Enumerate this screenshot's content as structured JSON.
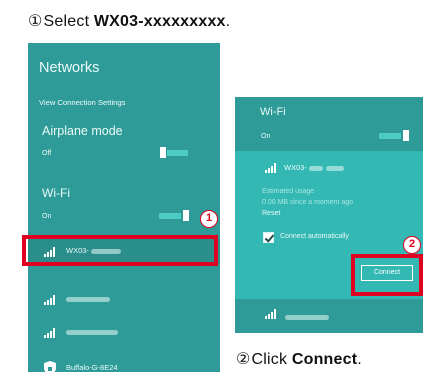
{
  "captions": {
    "step1_num": "①",
    "step1_prefix": "Select ",
    "step1_ssid": "WX03-xxxxxxxxx",
    "step1_suffix": ".",
    "step2_num": "②",
    "step2_prefix": "Click ",
    "step2_action": "Connect",
    "step2_suffix": "."
  },
  "left_panel": {
    "title": "Networks",
    "view_settings": "View Connection Settings",
    "airplane_label": "Airplane mode",
    "airplane_state": "Off",
    "airplane_on": false,
    "wifi_label": "Wi-Fi",
    "wifi_state": "On",
    "wifi_on": true,
    "networks": [
      {
        "name": "WX03-",
        "selected": true,
        "icon": "signal-bars-icon"
      },
      {
        "name": "",
        "selected": false,
        "icon": "signal-bars-icon"
      },
      {
        "name": "",
        "selected": false,
        "icon": "signal-bars-icon"
      },
      {
        "name": "Buffalo-G-8E24",
        "selected": false,
        "icon": "secured-shield-icon"
      }
    ]
  },
  "right_panel": {
    "title": "Wi-Fi",
    "wifi_state": "On",
    "wifi_on": true,
    "selected_network": "WX03-",
    "usage_label": "Estimated usage",
    "usage_value": "0.00 MB since a moment ago",
    "reset_label": "Reset",
    "auto_connect_label": "Connect automatically",
    "auto_connect_checked": true,
    "connect_label": "Connect",
    "other_network": ""
  },
  "badges": {
    "step1": "1",
    "step2": "2"
  },
  "colors": {
    "panel_bg": "#2f9b98",
    "selected_bg": "#34b8b4",
    "highlight": "#e00022",
    "toggle_track": "#4fcbc6"
  }
}
